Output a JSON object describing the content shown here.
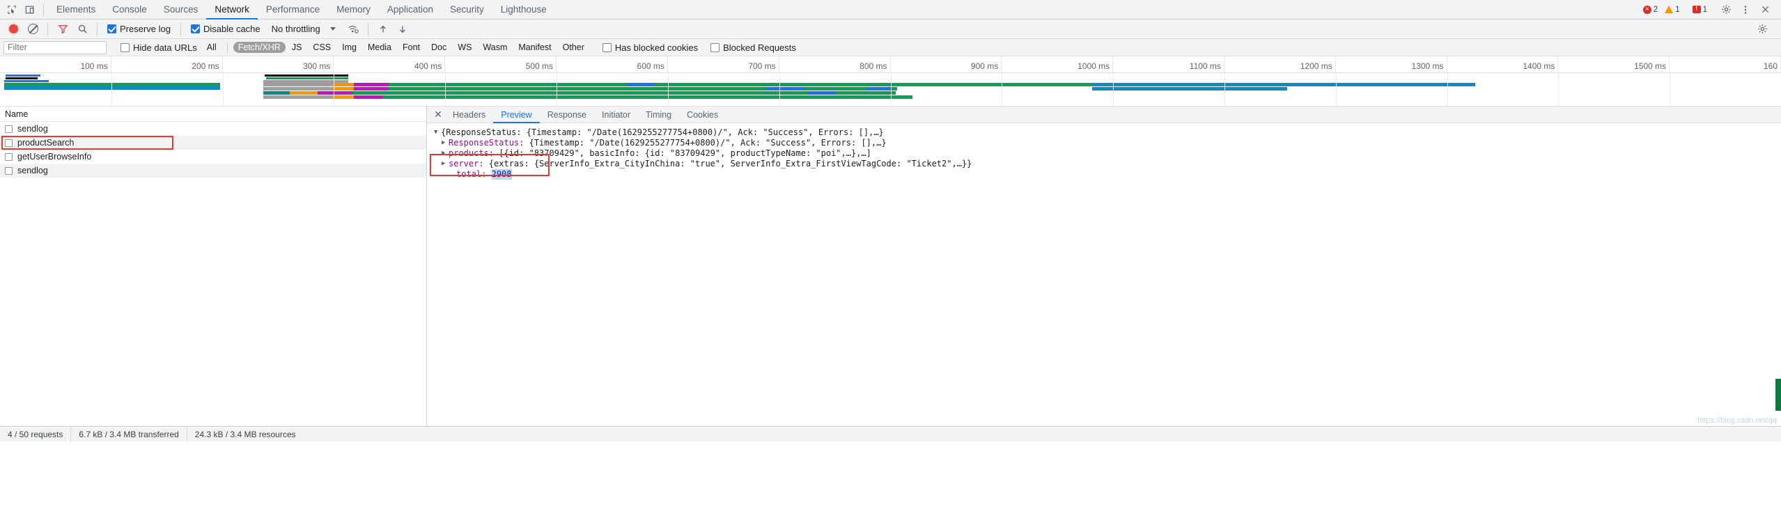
{
  "toolbar_top": {
    "icons": [
      "inspect-icon",
      "device-toggle-icon"
    ],
    "tabs": [
      {
        "label": "Elements",
        "active": false
      },
      {
        "label": "Console",
        "active": false
      },
      {
        "label": "Sources",
        "active": false
      },
      {
        "label": "Network",
        "active": true
      },
      {
        "label": "Performance",
        "active": false
      },
      {
        "label": "Memory",
        "active": false
      },
      {
        "label": "Application",
        "active": false
      },
      {
        "label": "Security",
        "active": false
      },
      {
        "label": "Lighthouse",
        "active": false
      }
    ],
    "errors_count": "2",
    "warnings_count": "1",
    "messages_count": "1",
    "settings_icon": "gear-icon",
    "more_icon": "kebab-menu-icon",
    "close_icon": "close-icon"
  },
  "network_toolbar": {
    "record_title": "record-button",
    "clear_title": "clear-button",
    "filter_title": "filter-icon",
    "search_title": "search-icon",
    "preserve_log": {
      "label": "Preserve log",
      "checked": true
    },
    "disable_cache": {
      "label": "Disable cache",
      "checked": true
    },
    "throttling": {
      "value": "No throttling"
    },
    "wifi_icon": "network-conditions-icon",
    "import_icon": "import-har-icon",
    "export_icon": "export-har-icon",
    "settings_icon": "network-settings-icon"
  },
  "filter_row": {
    "filter_placeholder": "Filter",
    "filter_value": "",
    "hide_data_urls": {
      "label": "Hide data URLs",
      "checked": false
    },
    "types": [
      {
        "label": "All",
        "selected": false
      },
      {
        "label": "Fetch/XHR",
        "selected": true
      },
      {
        "label": "JS",
        "selected": false
      },
      {
        "label": "CSS",
        "selected": false
      },
      {
        "label": "Img",
        "selected": false
      },
      {
        "label": "Media",
        "selected": false
      },
      {
        "label": "Font",
        "selected": false
      },
      {
        "label": "Doc",
        "selected": false
      },
      {
        "label": "WS",
        "selected": false
      },
      {
        "label": "Wasm",
        "selected": false
      },
      {
        "label": "Manifest",
        "selected": false
      },
      {
        "label": "Other",
        "selected": false
      }
    ],
    "has_blocked_cookies": {
      "label": "Has blocked cookies",
      "checked": false
    },
    "blocked_requests": {
      "label": "Blocked Requests",
      "checked": false
    }
  },
  "ruler": {
    "ticks": [
      "100 ms",
      "200 ms",
      "300 ms",
      "400 ms",
      "500 ms",
      "600 ms",
      "700 ms",
      "800 ms",
      "900 ms",
      "1000 ms",
      "1100 ms",
      "1200 ms",
      "1300 ms",
      "1400 ms",
      "1500 ms",
      "160"
    ]
  },
  "requests_panel": {
    "column_header": "Name",
    "rows": [
      {
        "name": "sendlog",
        "highlighted": false
      },
      {
        "name": "productSearch",
        "highlighted": true
      },
      {
        "name": "getUserBrowseInfo",
        "highlighted": false
      },
      {
        "name": "sendlog",
        "highlighted": false
      }
    ]
  },
  "detail_panel": {
    "close_label": "✕",
    "tabs": [
      {
        "label": "Headers",
        "active": false
      },
      {
        "label": "Preview",
        "active": true
      },
      {
        "label": "Response",
        "active": false
      },
      {
        "label": "Initiator",
        "active": false
      },
      {
        "label": "Timing",
        "active": false
      },
      {
        "label": "Cookies",
        "active": false
      }
    ],
    "preview_lines": [
      {
        "arrow": "▼",
        "indent": 0,
        "text": "{ResponseStatus: {Timestamp: \"/Date(1629255277754+0800)/\", Ack: \"Success\", Errors: [],…}"
      },
      {
        "arrow": "▶",
        "indent": 1,
        "key": "ResponseStatus:",
        "text": " {Timestamp: \"/Date(1629255277754+0800)/\", Ack: \"Success\", Errors: [],…}"
      },
      {
        "arrow": "▶",
        "indent": 1,
        "key": "products:",
        "text": " [{id: \"83709429\", basicInfo: {id: \"83709429\", productTypeName: \"poi\",…},…]"
      },
      {
        "arrow": "▶",
        "indent": 1,
        "key": "server:",
        "text": " {extras: {ServerInfo_Extra_CityInChina: \"true\", ServerInfo_Extra_FirstViewTagCode: \"Ticket2\",…}}"
      },
      {
        "arrow": "",
        "indent": 2,
        "key": "total:",
        "text": " ",
        "value": "2908"
      }
    ],
    "watermark": "https://blog.csdn.net/qq"
  },
  "status_bar": {
    "requests": "4 / 50 requests",
    "transferred": "6.7 kB / 3.4 MB transferred",
    "resources": "24.3 kB / 3.4 MB resources"
  },
  "colors": {
    "accent": "#1a73e8",
    "record": "#e8453c",
    "highlight": "#e53935",
    "selected_chip": "#9e9e9e",
    "wf_green": "#1a9c3a",
    "wf_gray": "#9e9e9e",
    "wf_orange": "#f29900",
    "wf_purple": "#c016c0",
    "wf_blue": "#1a73e8",
    "wf_teal": "#0a8a8a"
  }
}
